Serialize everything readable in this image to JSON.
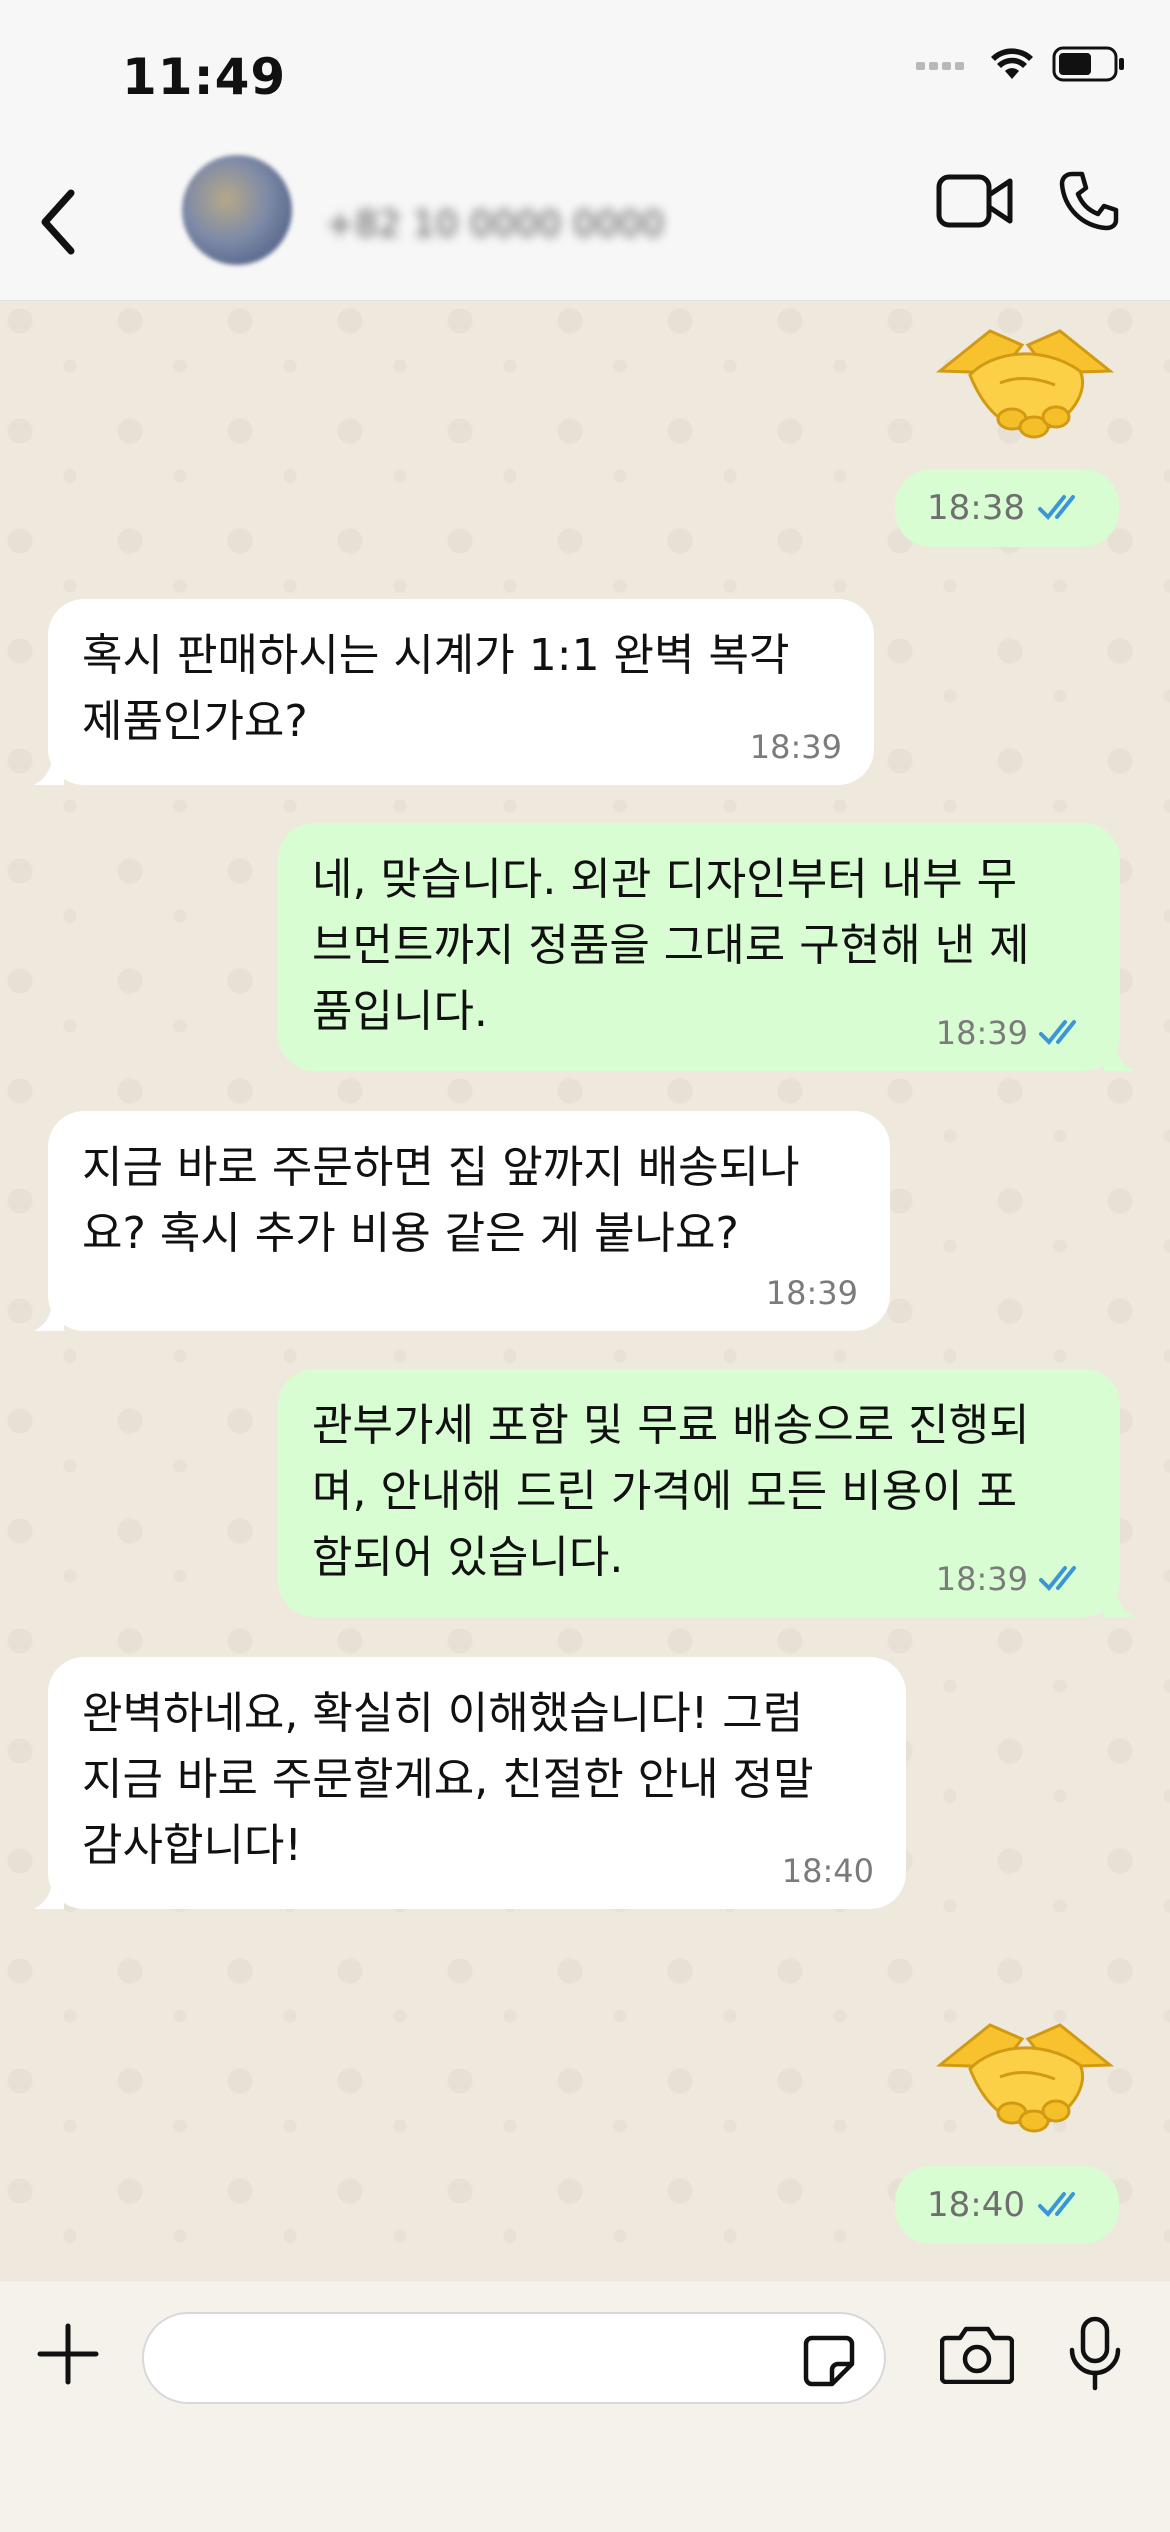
{
  "status_bar": {
    "time": "11:49"
  },
  "header": {
    "contact_name": "+82 10 0000 0000",
    "back_icon": "chevron-left-icon",
    "video_icon": "video-camera-icon",
    "call_icon": "phone-icon"
  },
  "messages": [
    {
      "type": "sticker",
      "emoji": "🤝",
      "direction": "out",
      "time": "18:38",
      "status": "read"
    },
    {
      "type": "text",
      "direction": "in",
      "text": "혹시 판매하시는 시계가 1:1 완벽 복각\n제품인가요?",
      "time": "18:39"
    },
    {
      "type": "text",
      "direction": "out",
      "text": "네, 맞습니다. 외관 디자인부터 내부 무\n브먼트까지 정품을 그대로 구현해 낸 제\n품입니다.",
      "time": "18:39",
      "status": "read"
    },
    {
      "type": "text",
      "direction": "in",
      "text": "지금 바로 주문하면 집 앞까지 배송되나\n요? 혹시 추가 비용 같은 게 붙나요?",
      "time": "18:39"
    },
    {
      "type": "text",
      "direction": "out",
      "text": "관부가세 포함 및 무료 배송으로 진행되\n며, 안내해 드린 가격에 모든 비용이 포\n함되어 있습니다.",
      "time": "18:39",
      "status": "read"
    },
    {
      "type": "text",
      "direction": "in",
      "text": "완벽하네요, 확실히 이해했습니다! 그럼\n지금 바로 주문할게요, 친절한 안내 정말\n감사합니다!",
      "time": "18:40"
    },
    {
      "type": "sticker",
      "emoji": "🤝",
      "direction": "out",
      "time": "18:40",
      "status": "read"
    }
  ],
  "composer": {
    "placeholder": "",
    "plus_icon": "plus-icon",
    "sticker_icon": "sticker-icon",
    "camera_icon": "camera-icon",
    "mic_icon": "microphone-icon"
  },
  "colors": {
    "incoming_bubble": "#ffffff",
    "outgoing_bubble": "#d9fdd3",
    "read_receipt": "#3b96d8",
    "chat_background": "#efe8dc"
  }
}
